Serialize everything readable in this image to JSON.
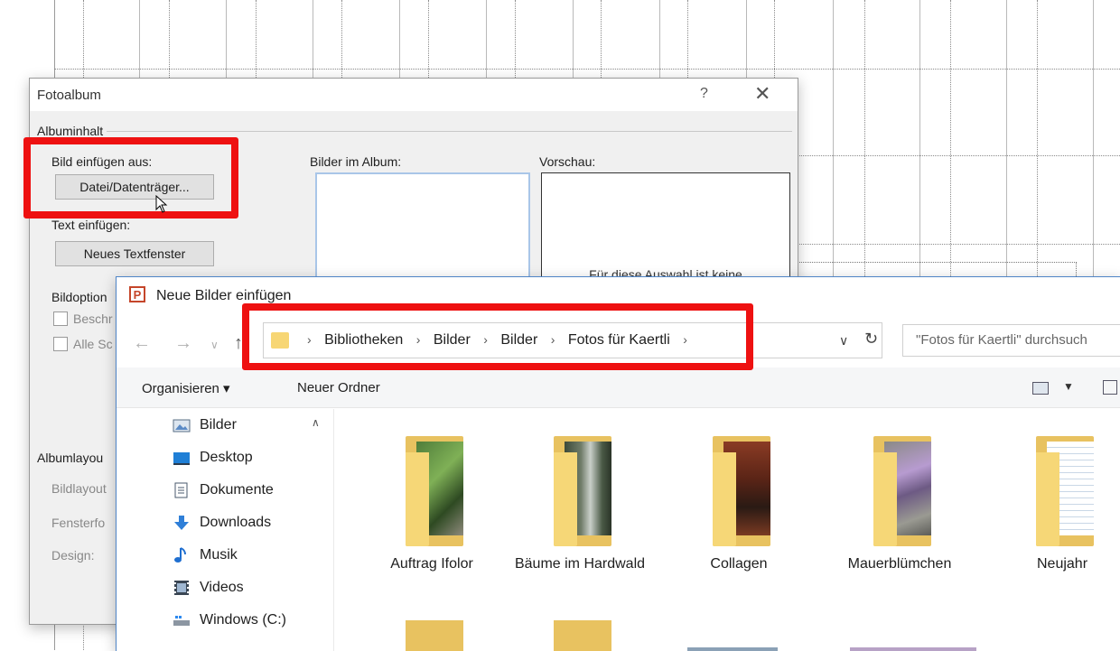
{
  "album_dialog": {
    "title": "Fotoalbum",
    "help": "?",
    "close": "✕",
    "group": "Albuminhalt",
    "insert_from_label": "Bild einfügen aus:",
    "file_button": "Datei/Datenträger...",
    "insert_text_label": "Text einfügen:",
    "new_textbox_button": "Neues Textfenster",
    "pictures_label": "Bilder im Album:",
    "preview_label": "Vorschau:",
    "preview_text": "Für diese Auswahl ist keine",
    "options_label": "Bildoption",
    "option_1": "Beschr",
    "option_2": "Alle Sc",
    "layout_label": "Albumlayou",
    "picture_layout": "Bildlayout",
    "frame_shape": "Fensterfo",
    "design": "Design:"
  },
  "file_dialog": {
    "title": "Neue Bilder einfügen",
    "app_icon": "P",
    "breadcrumbs": [
      "Bibliotheken",
      "Bilder",
      "Bilder",
      "Fotos für Kaertli"
    ],
    "search_placeholder": "\"Fotos für Kaertli\" durchsuch",
    "toolbar": {
      "organize": "Organisieren ▾",
      "new_folder": "Neuer Ordner"
    },
    "nav_items": [
      {
        "label": "Bilder",
        "icon": "pictures-icon"
      },
      {
        "label": "Desktop",
        "icon": "desktop-icon"
      },
      {
        "label": "Dokumente",
        "icon": "documents-icon"
      },
      {
        "label": "Downloads",
        "icon": "downloads-icon"
      },
      {
        "label": "Musik",
        "icon": "music-icon"
      },
      {
        "label": "Videos",
        "icon": "videos-icon"
      },
      {
        "label": "Windows (C:)",
        "icon": "drive-icon"
      }
    ],
    "folders": [
      {
        "label": "Auftrag Ifolor"
      },
      {
        "label": "Bäume im Hardwald"
      },
      {
        "label": "Collagen"
      },
      {
        "label": "Mauerblümchen"
      },
      {
        "label": "Neujahr"
      }
    ]
  },
  "colors": {
    "highlight": "#ee1111",
    "folder": "#f6d777",
    "dialog_border": "#4f85c7"
  }
}
